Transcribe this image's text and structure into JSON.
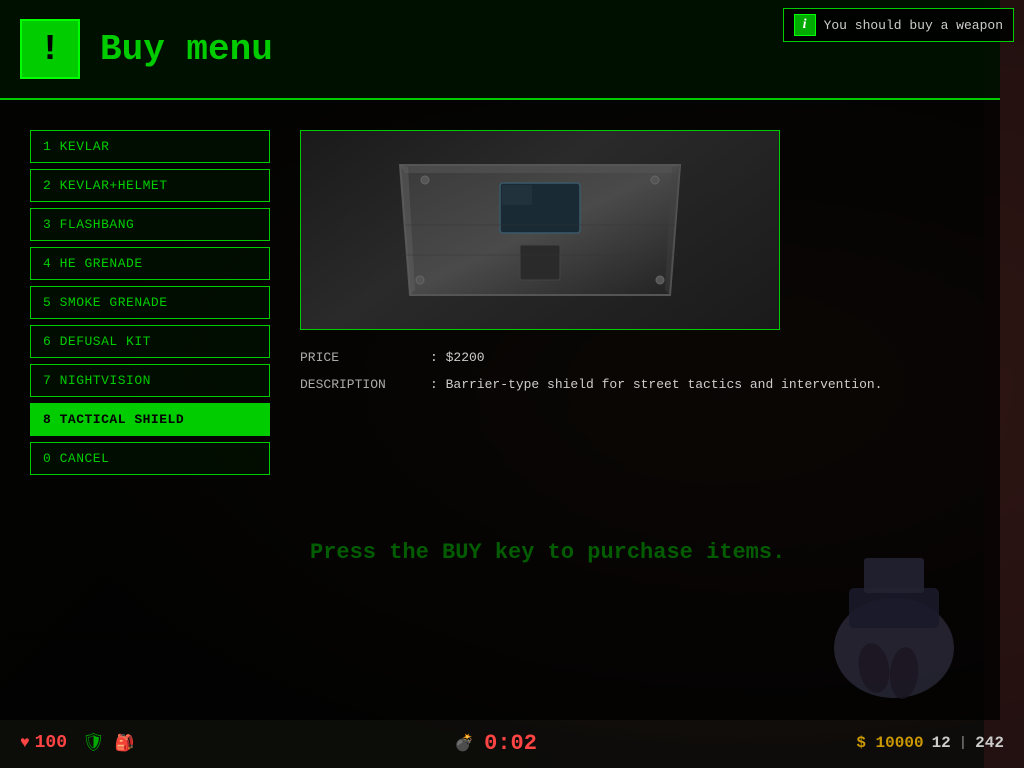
{
  "header": {
    "title": "Buy menu",
    "icon_label": "!"
  },
  "notification": {
    "icon": "i",
    "text": "You should buy a weapon"
  },
  "menu": {
    "items": [
      {
        "key": "1",
        "label": "1 KEVLAR",
        "active": false
      },
      {
        "key": "2",
        "label": "2 KEVLAR+HELMET",
        "active": false
      },
      {
        "key": "3",
        "label": "3 FLASHBANG",
        "active": false
      },
      {
        "key": "4",
        "label": "4 HE GRENADE",
        "active": false
      },
      {
        "key": "5",
        "label": "5 SMOKE GRENADE",
        "active": false
      },
      {
        "key": "6",
        "label": "6 DEFUSAL KIT",
        "active": false
      },
      {
        "key": "7",
        "label": "7 NIGHTVISION",
        "active": false
      },
      {
        "key": "8",
        "label": "8 TACTICAL SHIELD",
        "active": true
      },
      {
        "key": "0",
        "label": "0 CANCEL",
        "active": false
      }
    ]
  },
  "detail": {
    "price_label": "PRICE",
    "price_value": ": $2200",
    "description_label": "DESCRIPTION",
    "description_value": ": Barrier-type shield for street tactics and intervention."
  },
  "press_buy": "Press the BUY key to purchase items.",
  "hud": {
    "health_icon": "♥",
    "health": "100",
    "money": "$ 10000",
    "timer": "0:02",
    "bomb_icon": "●",
    "ammo_current": "12",
    "ammo_reserve": "242",
    "armor_icon": "🛡"
  }
}
